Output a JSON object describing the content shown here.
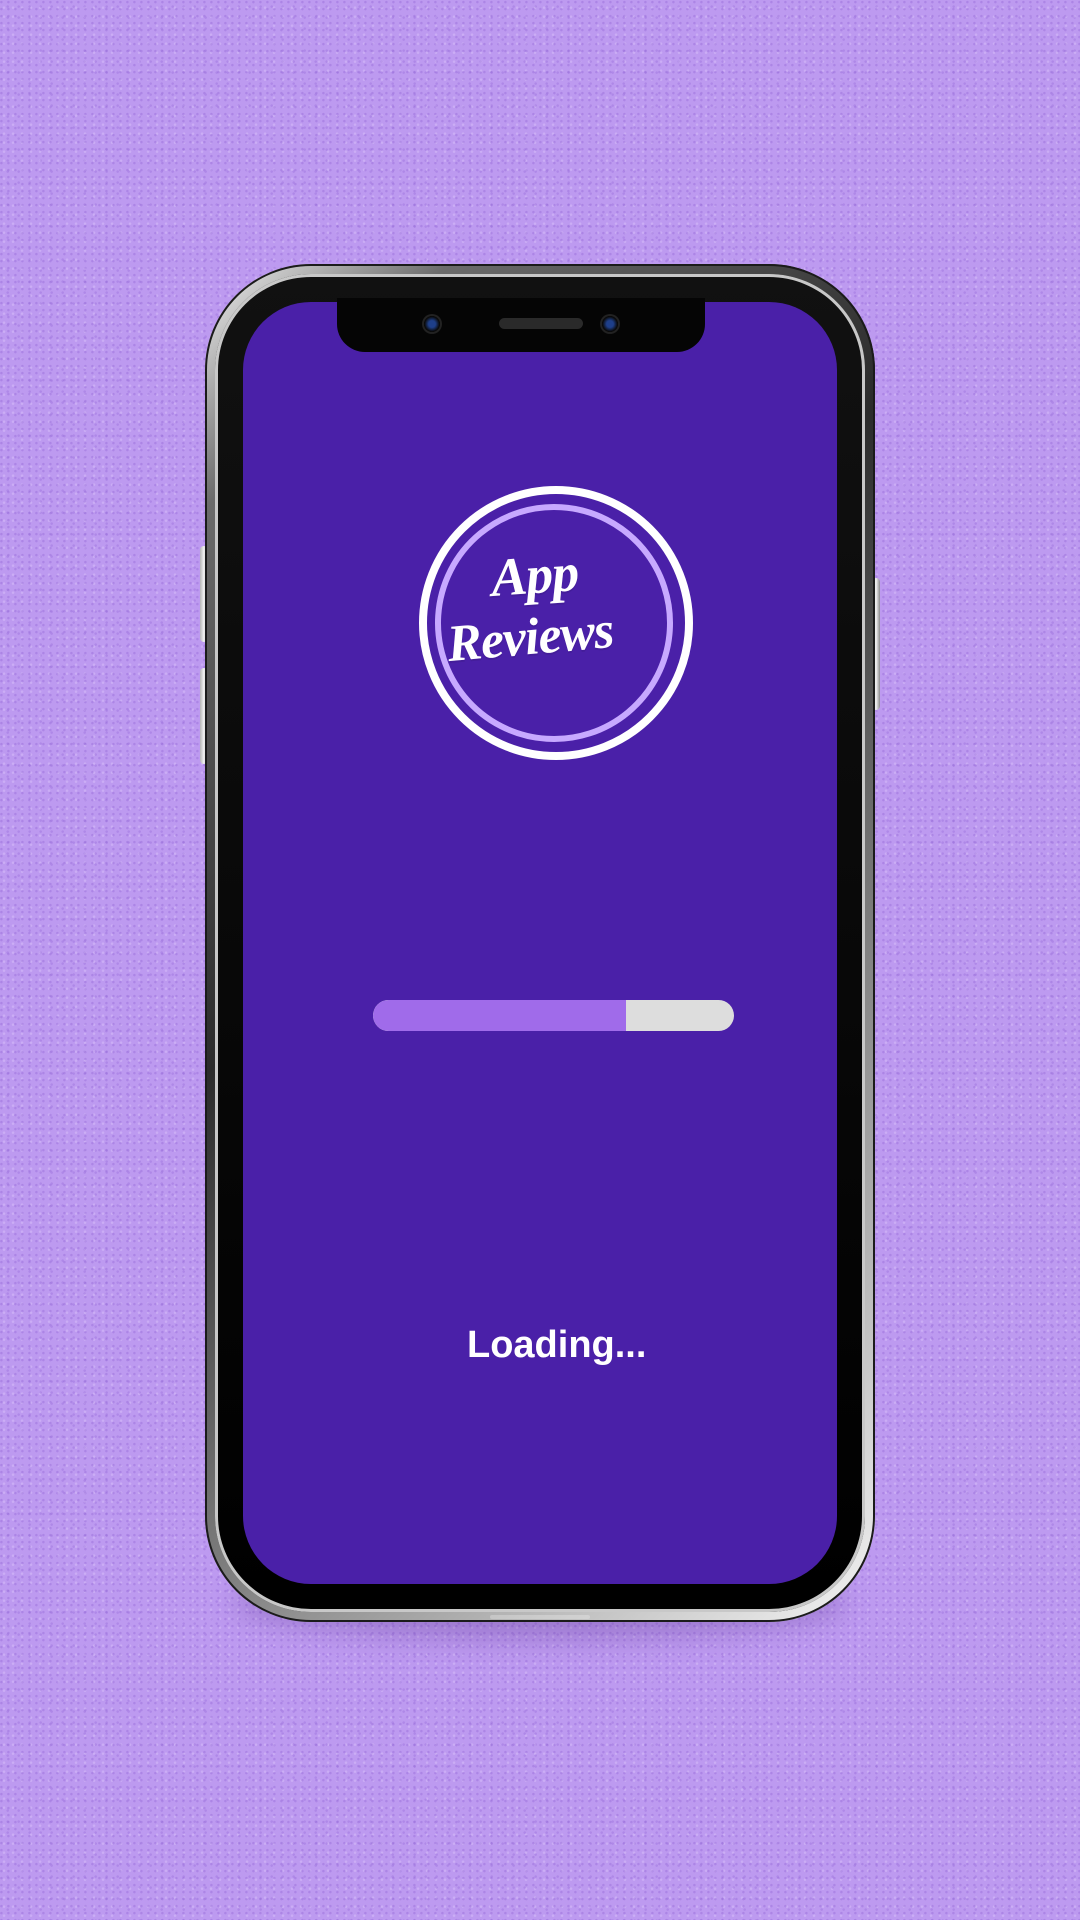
{
  "app": {
    "logo_line_1": "App",
    "logo_line_2": "Reviews",
    "loading_text": "Loading..."
  },
  "progress": {
    "value": 0.7
  },
  "colors": {
    "background": "#bd9af0",
    "screen": "#4a20a8",
    "progress_fill": "#a06bea",
    "progress_track": "#dddddd",
    "text": "#ffffff",
    "logo_inner_ring": "#c7a9ff"
  },
  "icons": {
    "camera_left": "camera-dot-icon",
    "camera_right": "camera-dot-icon",
    "speaker": "speaker-slit-icon"
  }
}
